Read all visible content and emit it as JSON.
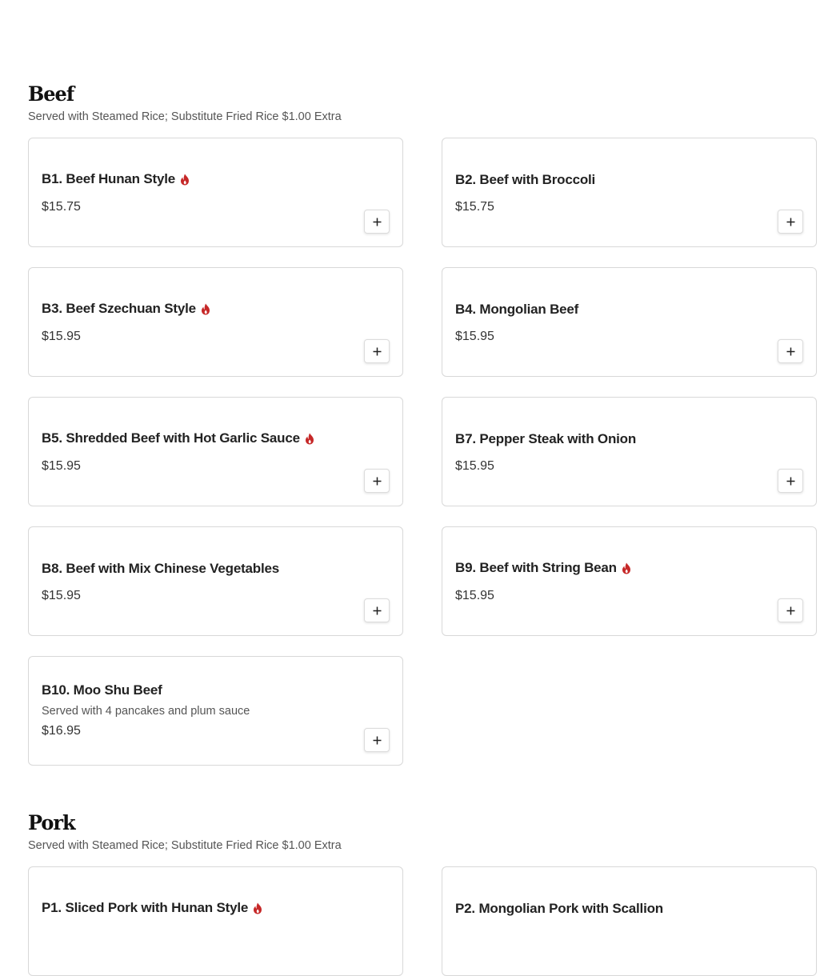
{
  "colors": {
    "spicy": "#c62828",
    "border": "#d8d8d8",
    "text": "#222222",
    "muted": "#555555"
  },
  "sections": [
    {
      "title": "Beef",
      "subtitle": "Served with Steamed Rice; Substitute Fried Rice $1.00 Extra",
      "items": [
        {
          "name": "B1. Beef Hunan Style",
          "price": "$15.75",
          "spicy": true,
          "icon": "spicy-icon"
        },
        {
          "name": "B2. Beef with Broccoli",
          "price": "$15.75",
          "spicy": false
        },
        {
          "name": "B3. Beef Szechuan Style",
          "price": "$15.95",
          "spicy": true,
          "icon": "spicy-icon"
        },
        {
          "name": "B4. Mongolian Beef",
          "price": "$15.95",
          "spicy": false
        },
        {
          "name": "B5. Shredded Beef with Hot Garlic Sauce",
          "price": "$15.95",
          "spicy": true,
          "icon": "spicy-icon"
        },
        {
          "name": "B7. Pepper Steak with Onion",
          "price": "$15.95",
          "spicy": false
        },
        {
          "name": "B8. Beef with Mix Chinese Vegetables",
          "price": "$15.95",
          "spicy": false
        },
        {
          "name": "B9. Beef with String Bean",
          "price": "$15.95",
          "spicy": true,
          "icon": "spicy-icon"
        },
        {
          "name": "B10. Moo Shu Beef",
          "description": "Served with 4 pancakes and plum sauce",
          "price": "$16.95",
          "spicy": false
        }
      ]
    },
    {
      "title": "Pork",
      "subtitle": "Served with Steamed Rice; Substitute Fried Rice $1.00 Extra",
      "items": [
        {
          "name": "P1. Sliced Pork with Hunan Style",
          "spicy": true,
          "icon": "spicy-icon"
        },
        {
          "name": "P2. Mongolian Pork with Scallion",
          "spicy": false
        }
      ]
    }
  ],
  "add_button_icon": "plus-icon"
}
